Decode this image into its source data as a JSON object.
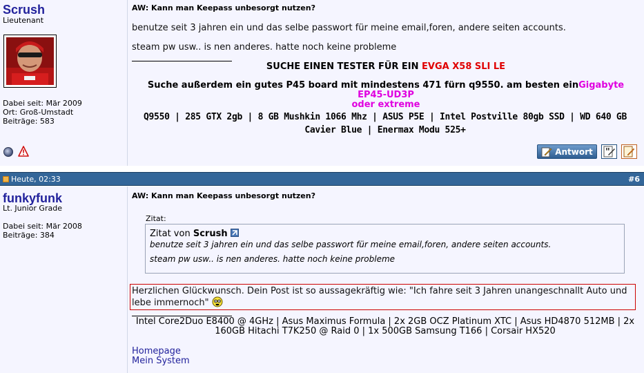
{
  "post1": {
    "username": "Scrush",
    "user_title": "Lieutenant",
    "joined": "Dabei seit: Mär 2009",
    "location": "Ort: Groß-Umstadt",
    "posts": "Beiträge: 583",
    "title": "AW: Kann man Keepass unbesorgt nutzen?",
    "body_line1": "benutze seit 3 jahren ein und das selbe passwort für meine email,foren, andere seiten accounts.",
    "body_line2": "steam pw usw.. is nen anderes. hatte noch keine probleme",
    "sig_search_prefix": "SUCHE EINEN TESTER FÜR EIN ",
    "sig_search_item": "EVGA X58 SLI LE",
    "sig_board_prefix": "Suche außerdem ein gutes P45 board mit mindestens 471 fürn q9550. am besten ein",
    "sig_board_item1": "Gigabyte EP45-UD3P",
    "sig_board_item2": "oder extreme",
    "sig_system": "Q9550 | 285 GTX 2gb | 8 GB Mushkin 1066 Mhz | ASUS P5E | Intel Postville 80gb SSD | WD 640 GB Cavier Blue | Enermax Modu 525+",
    "reply_label": "Antwort"
  },
  "post2": {
    "date": "Heute, 02:33",
    "number": "#6",
    "username": "funkyfunk",
    "user_title": "Lt. Junior Grade",
    "joined": "Dabei seit: Mär 2008",
    "posts": "Beiträge: 384",
    "title": "AW: Kann man Keepass unbesorgt nutzen?",
    "quote_label": "Zitat:",
    "quote_from_prefix": "Zitat von ",
    "quote_author": "Scrush",
    "quote_line1": "benutze seit 3 jahren ein und das selbe passwort für meine email,foren, andere seiten accounts.",
    "quote_line2": "steam pw usw.. is nen anderes. hatte noch keine probleme",
    "reply_text": "Herzlichen Glückwunsch. Dein Post ist so aussagekräftig wie: \"Ich fahre seit 3 Jahren unangeschnallt Auto und lebe immernoch\"",
    "sig_system": "Intel Core2Duo E8400 @ 4GHz | Asus Maximus Formula | 2x 2GB OCZ Platinum XTC | Asus HD4870 512MB | 2x 160GB Hitachi T7K250 @ Raid 0 | 1x 500GB Samsung T166 | Corsair HX520",
    "link_homepage": "Homepage",
    "link_system": "Mein System"
  },
  "colors": {
    "header_bar": "#336699",
    "post_bg": "#f5f5ff",
    "link": "#22229c",
    "sig_red": "#e00000",
    "sig_magenta": "#e000e0"
  }
}
